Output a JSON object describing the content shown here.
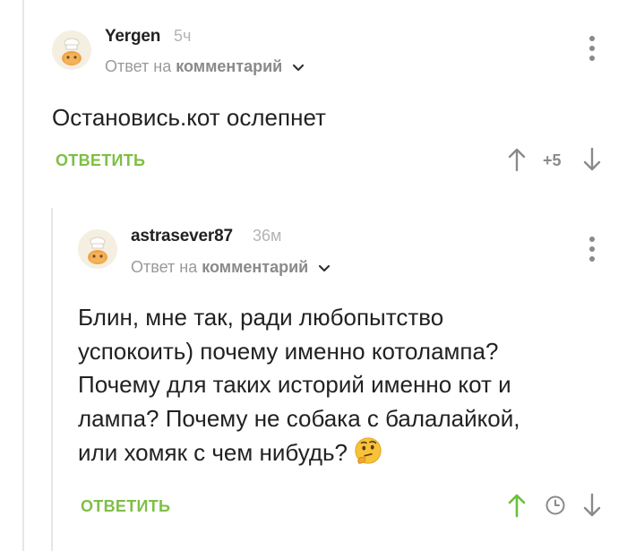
{
  "comment1": {
    "author": "Yergen",
    "time": "5ч",
    "reply_prefix": "Ответ на",
    "reply_target": "комментарий",
    "text": "Остановись.кот ослепнет",
    "reply_label": "ОТВЕТИТЬ",
    "rating": "+5"
  },
  "comment2": {
    "author": "astrasever87",
    "time": "36м",
    "reply_prefix": "Ответ на",
    "reply_target": "комментарий",
    "text_lines": [
      "Блин, мне так, ради любопытство",
      "успокоить) почему именно котолампа?",
      "Почему для таких историй именно кот и",
      "лампа? Почему не собака с балалайкой,",
      "или хомяк с чем нибудь?"
    ],
    "emoji": "thinking-face",
    "reply_label": "ОТВЕТИТЬ"
  },
  "colors": {
    "accent_green": "#7fbf45",
    "muted_gray": "#8a8a8a",
    "thread_line": "#e6e6e6"
  }
}
